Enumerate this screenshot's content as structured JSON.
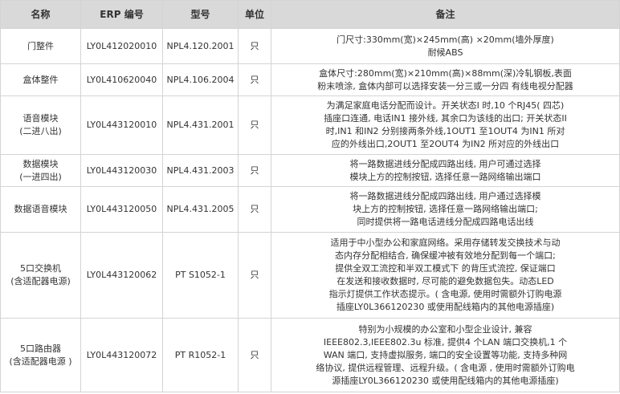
{
  "headers": [
    "名称",
    "ERP 编号",
    "型号",
    "单位",
    "备注"
  ],
  "rows": [
    {
      "name": [
        "门整件"
      ],
      "erp": "LY0L412020010",
      "model": "NPL4.120.2001",
      "unit": "只",
      "note": [
        "门尺寸:330mm(宽)×245mm(高) ×20mm(墙外厚度)",
        "耐候ABS"
      ]
    },
    {
      "name": [
        "盒体整件"
      ],
      "erp": "LY0L410620040",
      "model": "NPL4.106.2004",
      "unit": "只",
      "note": [
        "盒体尺寸:280mm(宽)×210mm(高)×88mm(深)冷轧钢板,表面",
        "粉末喷涂, 盒体内部可以选择安装一分三或一分四 有线电视分配器"
      ]
    },
    {
      "name": [
        "语音模块",
        "(二进八出)"
      ],
      "erp": "LY0L443120010",
      "model": "NPL4.431.2001",
      "unit": "只",
      "note": [
        "为满足家庭电话分配而设计。开关状态I 时,10 个RJ45( 四芯)",
        "插座口连通, 电话IN1 接外线, 其余口为该线的出口; 开关状态II",
        "时,IN1 和IN2 分别接两条外线,1OUT1 至1OUT4 为IN1 所对",
        "应的外线出口,2OUT1 至2OUT4 为IN2 所对应的外线出口"
      ]
    },
    {
      "name": [
        "数据模块",
        "(一进四出)"
      ],
      "erp": "LY0L443120030",
      "model": "NPL4.431.2003",
      "unit": "只",
      "note": [
        "将一路数据进线分配成四路出线, 用户可通过选择",
        "模块上方的控制按钮, 选择任意一路网络输出端口"
      ]
    },
    {
      "name": [
        "数据语音模块"
      ],
      "erp": "LY0L443120050",
      "model": "NPL4.431.2005",
      "unit": "只",
      "note": [
        "将一路数据进线分配成四路出线, 用户通过选择模",
        "块上方的控制按钮, 选择任意一路网络输出端口;",
        "同时提供将一路电话进线分配成四路电话出线"
      ]
    },
    {
      "name": [
        "5口交换机",
        "(含适配器电源)"
      ],
      "erp": "LY0L443120062",
      "model": "PT S1052-1",
      "unit": "只",
      "note": [
        "适用于中小型办公和家庭网络。采用存储转发交换技术与动",
        "态内存分配相结合, 确保缓冲被有效地分配到每一个端口;",
        "提供全双工流控和半双工模式下 的背压式流控, 保证端口",
        "在发送和接收数据时, 尽可能的避免数据包失。动态LED",
        "指示灯提供工作状态提示。( 含电源, 使用时需额外订购电源",
        "插座LY0L366120230 或使用配线箱内的其他电源插座)"
      ]
    },
    {
      "name": [
        "5口路由器",
        "(含适配器电源 )"
      ],
      "erp": "LY0L443120072",
      "model": "PT R1052-1",
      "unit": "只",
      "note": [
        "特别为小规模的办公室和小型企业设计, 兼容",
        "IEEE802.3,IEEE802.3u 标准, 提供4 个LAN 端口交换机,1 个",
        "WAN 端口, 支持虚拟服务, 端口的安全设置等功能, 支持多种网",
        "络协议, 提供远程管理、远程升级。( 含电源 , 使用时需额外订购电",
        "源插座LY0L366120230 或使用配线箱内的其他电源插座)"
      ]
    }
  ]
}
